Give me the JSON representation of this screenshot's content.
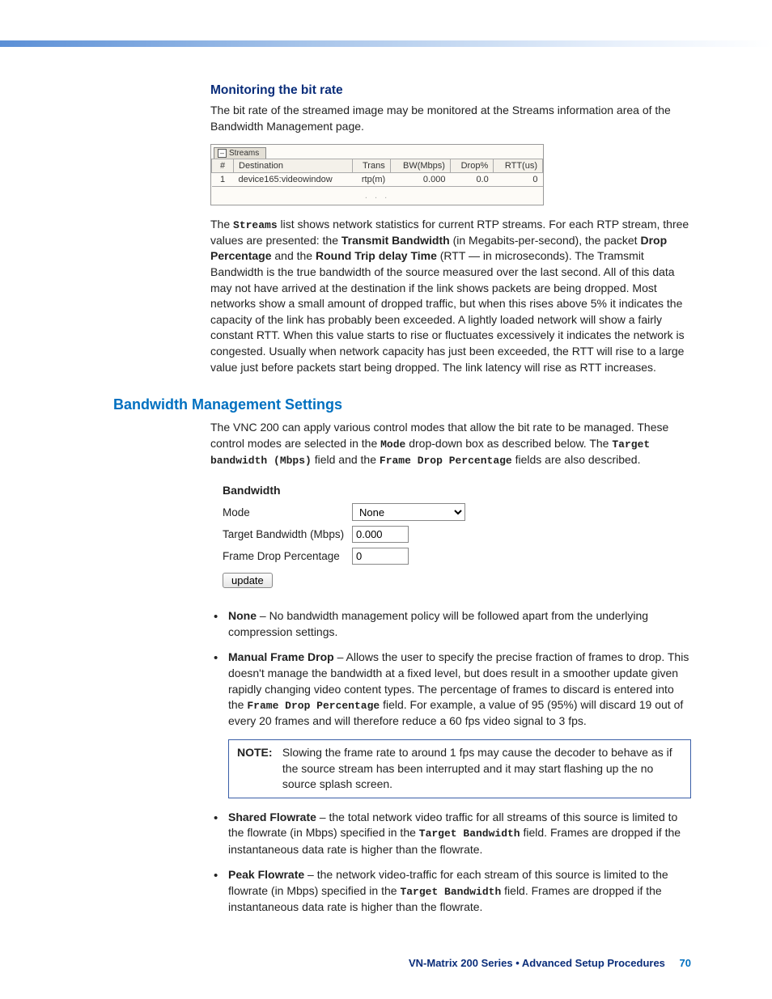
{
  "sec1": {
    "heading": "Monitoring the bit rate",
    "intro": "The bit rate of the streamed image may be monitored at the Streams information area of the Bandwidth Management page.",
    "streams_tab": "Streams",
    "table": {
      "headers": {
        "num": "#",
        "dest": "Destination",
        "trans": "Trans",
        "bw": "BW(Mbps)",
        "drop": "Drop%",
        "rtt": "RTT(us)"
      },
      "row": {
        "num": "1",
        "dest": "device165:videowindow",
        "trans": "rtp(m)",
        "bw": "0.000",
        "drop": "0.0",
        "rtt": "0"
      }
    },
    "para2_a": "The ",
    "para2_code1": "Streams",
    "para2_b": " list shows network statistics for current RTP streams. For each RTP stream, three values are presented: the ",
    "para2_bold1": "Transmit Bandwidth",
    "para2_c": " (in Megabits-per-second), the packet ",
    "para2_bold2": "Drop Percentage",
    "para2_d": " and the ",
    "para2_bold3": "Round Trip delay Time",
    "para2_e": " (RTT — in microseconds). The Tramsmit Bandwidth is the true bandwidth of the source measured over the last second. All of this data may not have arrived at the destination if the link shows packets are being dropped. Most networks show a small amount of dropped traffic, but when this rises above 5% it indicates the capacity of the link has probably been exceeded. A lightly loaded network will show a fairly constant RTT. When this value starts to rise or fluctuates excessively it indicates the network is congested. Usually when network capacity has just been exceeded, the RTT will rise to a large value just before packets start being dropped. The link latency will rise as RTT increases."
  },
  "sec2": {
    "heading": "Bandwidth Management Settings",
    "intro_a": "The VNC 200 can apply various control modes that allow the bit rate to be managed. These control modes are selected in the ",
    "intro_code1": "Mode",
    "intro_b": " drop-down box as described below. The ",
    "intro_code2": "Target bandwidth (Mbps)",
    "intro_c": " field and the ",
    "intro_code3": "Frame Drop Percentage",
    "intro_d": " fields are also described.",
    "form": {
      "title": "Bandwidth",
      "mode_label": "Mode",
      "mode_value": "None",
      "tbw_label": "Target Bandwidth (Mbps)",
      "tbw_value": "0.000",
      "fdp_label": "Frame Drop Percentage",
      "fdp_value": "0",
      "update": "update"
    },
    "bullets": {
      "none_label": "None",
      "none_text": " – No bandwidth management policy will be followed apart from the underlying compression settings.",
      "mfd_label": "Manual Frame Drop",
      "mfd_a": " – Allows the user to specify the precise fraction of frames to drop. This doesn't manage the bandwidth at a fixed level, but does result in a smoother update given rapidly changing video content types. The percentage of frames to discard is entered into the ",
      "mfd_code": "Frame Drop Percentage",
      "mfd_b": " field. For example, a value of 95 (95%) will discard 19 out of every 20 frames and will therefore reduce a 60 fps video signal to 3 fps.",
      "note_label": "NOTE:",
      "note_text": "Slowing the frame rate to around 1 fps may cause the decoder to behave as if the source stream has been interrupted and it may start flashing up the no source splash screen.",
      "sf_label": "Shared Flowrate",
      "sf_a": " – the total network video traffic for all streams of this source is limited to the flowrate (in Mbps) specified in the ",
      "sf_code": "Target Bandwidth",
      "sf_b": " field. Frames are dropped if the instantaneous data rate is higher than the flowrate.",
      "pf_label": "Peak Flowrate",
      "pf_a": " – the network video-traffic for each stream of this source is limited to the flowrate (in Mbps) specified in the ",
      "pf_code": "Target Bandwidth",
      "pf_b": " field. Frames are dropped if the instantaneous data rate is higher than the flowrate."
    }
  },
  "footer": {
    "text": "VN-Matrix 200 Series  •  Advanced Setup Procedures",
    "page": "70"
  }
}
